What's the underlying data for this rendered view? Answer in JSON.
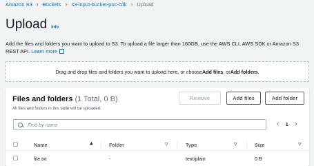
{
  "breadcrumb": {
    "items": [
      "Amazon S3",
      "Buckets",
      "s3-input-bucket-poc-cdk"
    ],
    "current": "Upload"
  },
  "header": {
    "title": "Upload",
    "info_label": "Info"
  },
  "description": {
    "text": "Add the files and folders you want to upload to S3. To upload a file larger than 160GB, use the AWS CLI, AWS SDK or Amazon S3 REST API.",
    "link_label": "Learn more"
  },
  "dropzone": {
    "prefix": "Drag and drop files and folders you want to upload here, or choose ",
    "files_label": "Add files",
    "middle": ", or ",
    "folders_label": "Add folders",
    "suffix": "."
  },
  "files_panel": {
    "title": "Files and folders",
    "count": "(1 Total, 0 B)",
    "subtitle": "All files and folders in this table will be uploaded.",
    "buttons": {
      "remove": "Remove",
      "add_files": "Add files",
      "add_folder": "Add folder"
    },
    "search_placeholder": "Find by name",
    "pagination": {
      "page": "1"
    },
    "columns": [
      "Name",
      "Folder",
      "Type",
      "Size"
    ],
    "sorted_column": "Name",
    "rows": [
      {
        "name": "file.txt",
        "folder": "-",
        "type": "text/plain",
        "size": "0 B"
      }
    ]
  },
  "colors": {
    "link": "#0073bb",
    "background": "#f2f3f3",
    "text": "#16191f"
  },
  "icons": [
    "chevron-right-icon",
    "external-link-icon",
    "search-icon",
    "sort-down-icon",
    "sort-indicator-icon",
    "chevron-left-icon",
    "checkbox-icon"
  ]
}
